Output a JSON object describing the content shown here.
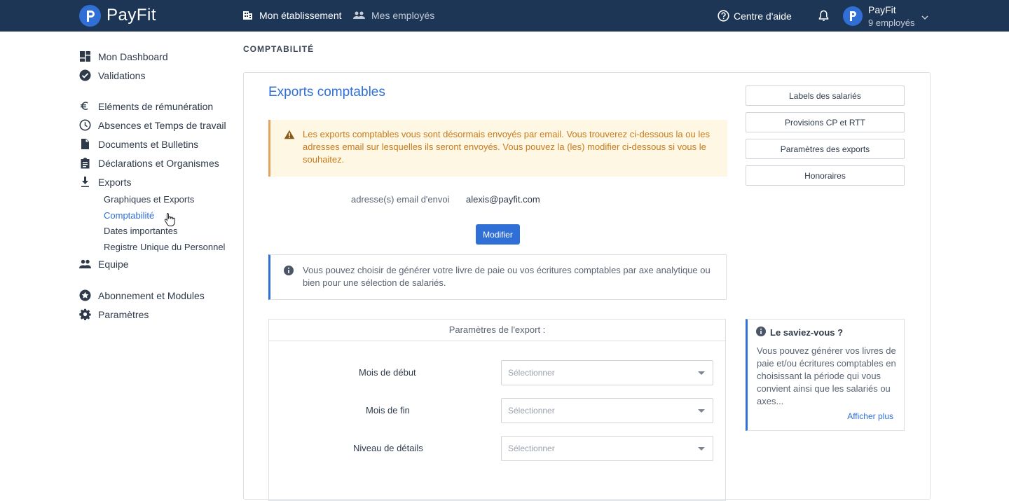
{
  "topbar": {
    "brand": "PayFit",
    "nav": [
      {
        "label": "Mon établissement",
        "icon": "building-icon"
      },
      {
        "label": "Mes employés",
        "icon": "people-icon"
      }
    ],
    "help_label": "Centre d'aide",
    "company_name": "PayFit",
    "company_employees": "9 employés"
  },
  "sidebar": {
    "items": [
      {
        "label": "Mon Dashboard",
        "icon": "dashboard-icon"
      },
      {
        "label": "Validations",
        "icon": "check-circle-icon"
      },
      {
        "label": "Eléments de rémunération",
        "icon": "euro-icon"
      },
      {
        "label": "Absences et Temps de travail",
        "icon": "clock-icon"
      },
      {
        "label": "Documents et Bulletins",
        "icon": "document-icon"
      },
      {
        "label": "Déclarations et Organismes",
        "icon": "clipboard-icon"
      },
      {
        "label": "Exports",
        "icon": "download-icon"
      },
      {
        "label": "Equipe",
        "icon": "people-icon"
      },
      {
        "label": "Abonnement et Modules",
        "icon": "star-icon"
      },
      {
        "label": "Paramètres",
        "icon": "gear-icon"
      }
    ],
    "sub_items": [
      {
        "label": "Graphiques et Exports"
      },
      {
        "label": "Comptabilité"
      },
      {
        "label": "Dates importantes"
      },
      {
        "label": "Registre Unique du Personnel"
      }
    ]
  },
  "breadcrumb": "COMPTABILITÉ",
  "main": {
    "title": "Exports comptables",
    "warning": "Les exports comptables vous sont désormais envoyés par email. Vous trouverez ci-dessous la ou les adresses email sur lesquelles ils seront envoyés. Vous pouvez la (les) modifier ci-dessous si vous le souhaitez.",
    "email_label": "adresse(s) email d'envoi",
    "email_value": "alexis@payfit.com",
    "modify_label": "Modifier",
    "info": "Vous pouvez choisir de générer votre livre de paie ou vos écritures comptables par axe analytique ou bien pour une sélection de salariés.",
    "export_params_title": "Paramètres de l'export :",
    "fields": [
      {
        "label": "Mois de début",
        "placeholder": "Sélectionner"
      },
      {
        "label": "Mois de fin",
        "placeholder": "Sélectionner"
      },
      {
        "label": "Niveau de détails",
        "placeholder": "Sélectionner"
      }
    ]
  },
  "side_buttons": [
    {
      "label": "Labels des salariés"
    },
    {
      "label": "Provisions CP et RTT"
    },
    {
      "label": "Paramètres des exports"
    },
    {
      "label": "Honoraires"
    }
  ],
  "tip": {
    "title": "Le saviez-vous ?",
    "text": "Vous pouvez générer vos livres de paie et/ou écritures comptables en choisissant la période qui vous convient ainsi que les salariés ou axes...",
    "link": "Afficher plus"
  },
  "colors": {
    "topbar": "#1e3655",
    "accent": "#2f6fd6",
    "warning_bg": "#fdf7e3",
    "warning_text": "#c97a1c"
  }
}
